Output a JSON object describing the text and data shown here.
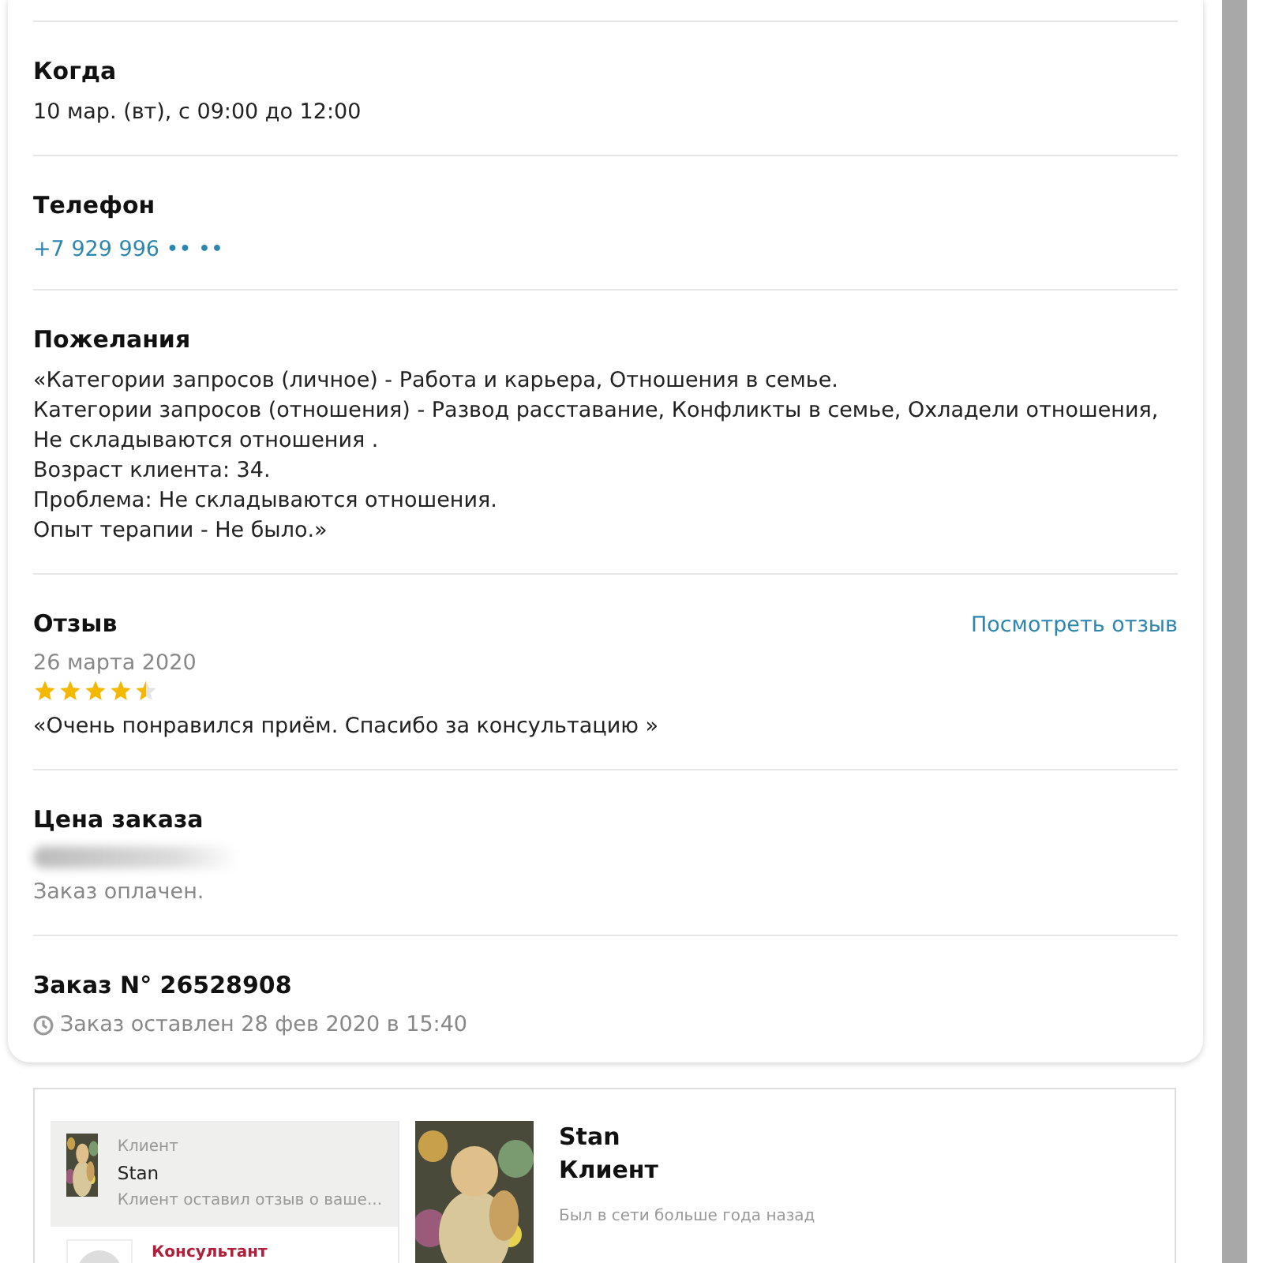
{
  "sections": [
    {
      "kind": "text",
      "title": "Когда",
      "lines": [
        "10 мар. (вт), с 09:00 до 12:00"
      ]
    },
    {
      "kind": "link",
      "title": "Телефон",
      "lines": [
        "+7 929 996 •• ••"
      ]
    },
    {
      "kind": "text",
      "title": "Пожелания",
      "lines": [
        "«Категории запросов (личное) - Работа и карьера, Отношения в семье.",
        "Категории запросов (отношения) - Развод расставание, Конфликты в семье, Охладели отношения,",
        "Не складываются отношения .",
        "Возраст клиента: 34.",
        "Проблема: Не складываются отношения.",
        "Опыт терапии - Не было.»"
      ]
    },
    {
      "kind": "review",
      "title": "Отзыв",
      "action": "Посмотреть отзыв",
      "date": "26 марта 2020",
      "stars": 4.5,
      "lines": [
        "«Очень понравился приём. Спасибо за консультацию »"
      ]
    },
    {
      "kind": "price",
      "title": "Цена заказа",
      "lines": [
        "Заказ оплачен."
      ]
    },
    {
      "kind": "order",
      "title": "Заказ N° 26528908",
      "lines": [
        "Заказ оставлен 28 фев 2020 в 15:40"
      ]
    }
  ],
  "chat": {
    "contacts": [
      {
        "role": "Клиент",
        "name": "Stan",
        "preview": "Клиент оставил отзыв о ваше...",
        "selected": true,
        "kind": "picture"
      },
      {
        "role": "Консультант",
        "selected": false,
        "kind": "placeholder"
      }
    ],
    "profile": {
      "name": "Stan",
      "role": "Клиент",
      "status": "Был в сети больше года назад"
    }
  }
}
